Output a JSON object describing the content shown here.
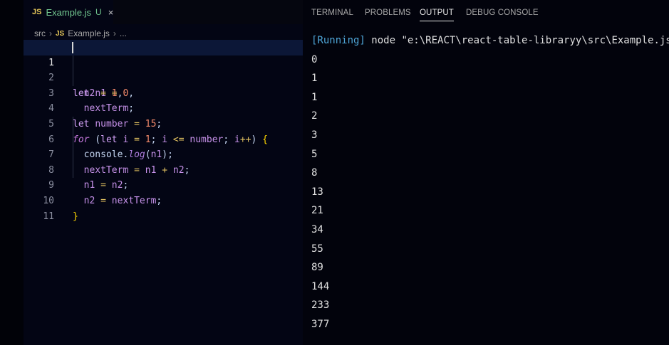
{
  "tab": {
    "lang_badge": "JS",
    "filename": "Example.js",
    "status": "U",
    "close": "×"
  },
  "breadcrumb": {
    "folder": "src",
    "lang_badge": "JS",
    "file": "Example.js",
    "more": "..."
  },
  "editor": {
    "line_numbers": [
      "1",
      "2",
      "3",
      "4",
      "5",
      "6",
      "7",
      "8",
      "9",
      "10",
      "11"
    ],
    "current_line": "1"
  },
  "panel": {
    "tabs": [
      "TERMINAL",
      "PROBLEMS",
      "OUTPUT",
      "DEBUG CONSOLE"
    ],
    "active_tab": "OUTPUT"
  },
  "output": {
    "run_tag": "[Running]",
    "command": "node \"e:\\REACT\\react-table-libraryy\\src\\Example.js\"",
    "lines": [
      "0",
      "1",
      "1",
      "2",
      "3",
      "5",
      "8",
      "13",
      "21",
      "34",
      "55",
      "89",
      "144",
      "233",
      "377"
    ]
  }
}
